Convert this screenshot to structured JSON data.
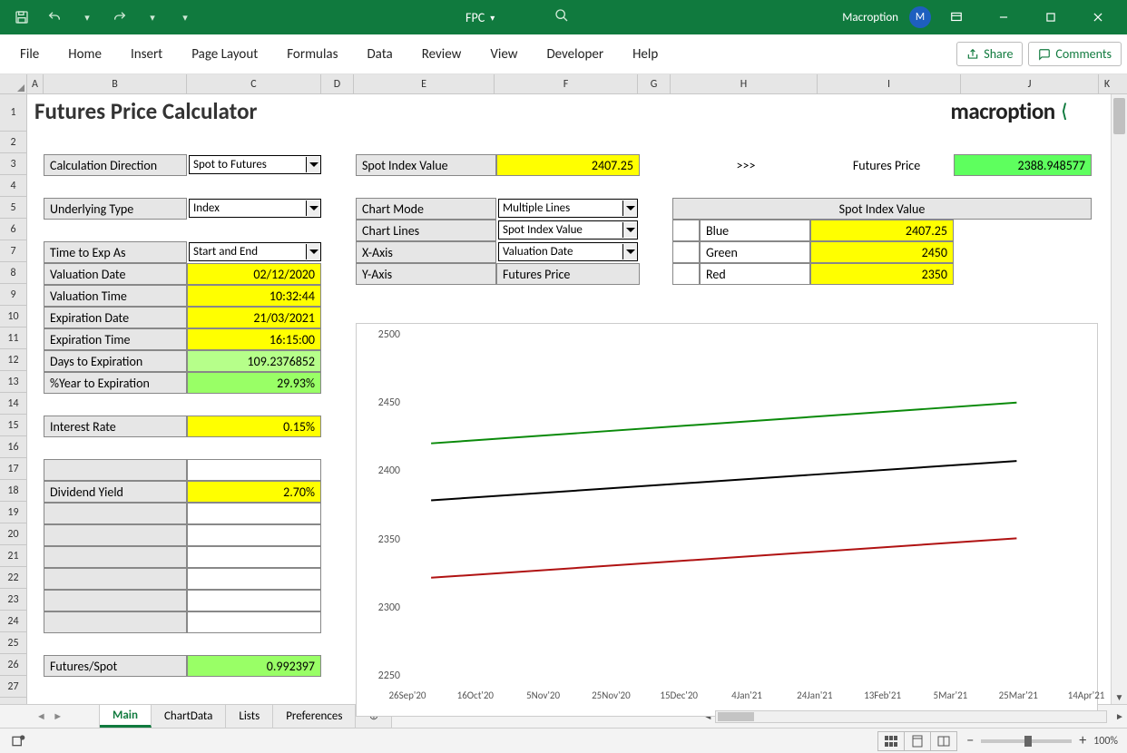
{
  "app": {
    "doc_name": "FPC",
    "user": "Macroption",
    "avatar_letter": "M",
    "share_label": "Share",
    "comments_label": "Comments",
    "zoom": "100%"
  },
  "menu": [
    "File",
    "Home",
    "Insert",
    "Page Layout",
    "Formulas",
    "Data",
    "Review",
    "View",
    "Developer",
    "Help"
  ],
  "columns": [
    "A",
    "B",
    "C",
    "D",
    "E",
    "F",
    "G",
    "H",
    "I",
    "J",
    "K"
  ],
  "rows": [
    1,
    2,
    3,
    4,
    5,
    6,
    7,
    8,
    9,
    10,
    11,
    12,
    13,
    14,
    15,
    16,
    17,
    18,
    19,
    20,
    21,
    22,
    23,
    24,
    25,
    26,
    27
  ],
  "sheet": {
    "title": "Futures Price Calculator",
    "brand": "macroption",
    "inputs": {
      "calc_dir_lbl": "Calculation Direction",
      "calc_dir_val": "Spot to Futures",
      "under_type_lbl": "Underlying Type",
      "under_type_val": "Index",
      "time_as_lbl": "Time to Exp As",
      "time_as_val": "Start and End",
      "val_date_lbl": "Valuation Date",
      "val_date_val": "02/12/2020",
      "val_time_lbl": "Valuation Time",
      "val_time_val": "10:32:44",
      "exp_date_lbl": "Expiration Date",
      "exp_date_val": "21/03/2021",
      "exp_time_lbl": "Expiration Time",
      "exp_time_val": "16:15:00",
      "days_lbl": "Days to Expiration",
      "days_val": "109.2376852",
      "pctyear_lbl": "%Year to Expiration",
      "pctyear_val": "29.93%",
      "rate_lbl": "Interest Rate",
      "rate_val": "0.15%",
      "divy_lbl": "Dividend Yield",
      "divy_val": "2.70%",
      "fspot_lbl": "Futures/Spot",
      "fspot_val": "0.992397"
    },
    "top_right": {
      "spot_lbl": "Spot Index Value",
      "spot_val": "2407.25",
      "arrow": ">>>",
      "fprice_lbl": "Futures Price",
      "fprice_val": "2388.948577"
    },
    "chart_ctl": {
      "chart_mode_lbl": "Chart Mode",
      "chart_mode_val": "Multiple Lines",
      "chart_lines_lbl": "Chart Lines",
      "chart_lines_val": "Spot Index Value",
      "xaxis_lbl": "X-Axis",
      "xaxis_val": "Valuation Date",
      "yaxis_lbl": "Y-Axis",
      "yaxis_val": "Futures Price",
      "col_header": "Spot Index Value",
      "blue_lbl": "Blue",
      "blue_val": "2407.25",
      "green_lbl": "Green",
      "green_val": "2450",
      "red_lbl": "Red",
      "red_val": "2350"
    }
  },
  "tabs": [
    "Main",
    "ChartData",
    "Lists",
    "Preferences"
  ],
  "chart_data": {
    "type": "line",
    "xlabel": "",
    "ylabel": "",
    "ylim": [
      2250,
      2500
    ],
    "xticks": [
      "26Sep'20",
      "16Oct'20",
      "5Nov'20",
      "25Nov'20",
      "15Dec'20",
      "4Jan'21",
      "24Jan'21",
      "13Feb'21",
      "5Mar'21",
      "25Mar'21",
      "14Apr'21"
    ],
    "yticks": [
      2250,
      2300,
      2350,
      2400,
      2450,
      2500
    ],
    "series": [
      {
        "name": "Green",
        "color": "#0a8a0a",
        "x": [
          0,
          1
        ],
        "y": [
          2420,
          2450
        ]
      },
      {
        "name": "Blue",
        "color": "#000000",
        "x": [
          0,
          1
        ],
        "y": [
          2378,
          2407
        ]
      },
      {
        "name": "Red",
        "color": "#b01212",
        "x": [
          0,
          1
        ],
        "y": [
          2321,
          2350
        ]
      }
    ]
  }
}
